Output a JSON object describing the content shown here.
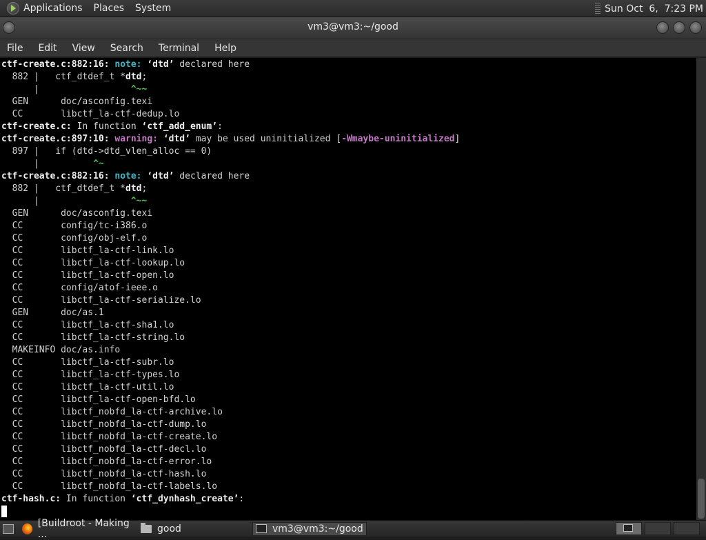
{
  "top_panel": {
    "menus": [
      "Applications",
      "Places",
      "System"
    ],
    "clock": "Sun Oct  6,  7:23 PM"
  },
  "window": {
    "title": "vm3@vm3:~/good"
  },
  "menubar": {
    "items": [
      "File",
      "Edit",
      "View",
      "Search",
      "Terminal",
      "Help"
    ]
  },
  "terminal": {
    "lines": [
      [
        [
          "ctf-create.c:882:16:",
          "b"
        ],
        [
          " ",
          ""
        ],
        [
          "note:",
          "note"
        ],
        [
          " ",
          ""
        ],
        [
          "‘dtd’",
          "q"
        ],
        [
          " declared here",
          ""
        ]
      ],
      [
        [
          "  882 |   ctf_dtdef_t *",
          ""
        ],
        [
          "dtd",
          "b"
        ],
        [
          ";",
          ""
        ]
      ],
      [
        [
          "      |                 ",
          ""
        ],
        [
          "^~~",
          "car"
        ]
      ],
      [
        [
          "  GEN      doc/asconfig.texi",
          ""
        ]
      ],
      [
        [
          "  CC       libctf_la-ctf-dedup.lo",
          ""
        ]
      ],
      [
        [
          "ctf-create.c:",
          "b"
        ],
        [
          " In function ",
          ""
        ],
        [
          "‘ctf_add_enum’",
          "q"
        ],
        [
          ":",
          ""
        ]
      ],
      [
        [
          "ctf-create.c:897:10:",
          "b"
        ],
        [
          " ",
          ""
        ],
        [
          "warning:",
          "warn"
        ],
        [
          " ",
          ""
        ],
        [
          "‘dtd’",
          "q"
        ],
        [
          " may be used uninitialized [",
          ""
        ],
        [
          "-Wmaybe-uninitialized",
          "warn"
        ],
        [
          "]",
          ""
        ]
      ],
      [
        [
          "  897 |   if (dtd->dtd_vlen_alloc == 0)",
          ""
        ]
      ],
      [
        [
          "      |          ",
          ""
        ],
        [
          "^~",
          "car"
        ]
      ],
      [
        [
          "ctf-create.c:882:16:",
          "b"
        ],
        [
          " ",
          ""
        ],
        [
          "note:",
          "note"
        ],
        [
          " ",
          ""
        ],
        [
          "‘dtd’",
          "q"
        ],
        [
          " declared here",
          ""
        ]
      ],
      [
        [
          "  882 |   ctf_dtdef_t *",
          ""
        ],
        [
          "dtd",
          "b"
        ],
        [
          ";",
          ""
        ]
      ],
      [
        [
          "      |                 ",
          ""
        ],
        [
          "^~~",
          "car"
        ]
      ],
      [
        [
          "  GEN      doc/asconfig.texi",
          ""
        ]
      ],
      [
        [
          "  CC       config/tc-i386.o",
          ""
        ]
      ],
      [
        [
          "  CC       config/obj-elf.o",
          ""
        ]
      ],
      [
        [
          "  CC       libctf_la-ctf-link.lo",
          ""
        ]
      ],
      [
        [
          "  CC       libctf_la-ctf-lookup.lo",
          ""
        ]
      ],
      [
        [
          "  CC       libctf_la-ctf-open.lo",
          ""
        ]
      ],
      [
        [
          "  CC       config/atof-ieee.o",
          ""
        ]
      ],
      [
        [
          "  CC       libctf_la-ctf-serialize.lo",
          ""
        ]
      ],
      [
        [
          "  GEN      doc/as.1",
          ""
        ]
      ],
      [
        [
          "  CC       libctf_la-ctf-sha1.lo",
          ""
        ]
      ],
      [
        [
          "  CC       libctf_la-ctf-string.lo",
          ""
        ]
      ],
      [
        [
          "  MAKEINFO doc/as.info",
          ""
        ]
      ],
      [
        [
          "  CC       libctf_la-ctf-subr.lo",
          ""
        ]
      ],
      [
        [
          "  CC       libctf_la-ctf-types.lo",
          ""
        ]
      ],
      [
        [
          "  CC       libctf_la-ctf-util.lo",
          ""
        ]
      ],
      [
        [
          "  CC       libctf_la-ctf-open-bfd.lo",
          ""
        ]
      ],
      [
        [
          "  CC       libctf_nobfd_la-ctf-archive.lo",
          ""
        ]
      ],
      [
        [
          "  CC       libctf_nobfd_la-ctf-dump.lo",
          ""
        ]
      ],
      [
        [
          "  CC       libctf_nobfd_la-ctf-create.lo",
          ""
        ]
      ],
      [
        [
          "  CC       libctf_nobfd_la-ctf-decl.lo",
          ""
        ]
      ],
      [
        [
          "  CC       libctf_nobfd_la-ctf-error.lo",
          ""
        ]
      ],
      [
        [
          "  CC       libctf_nobfd_la-ctf-hash.lo",
          ""
        ]
      ],
      [
        [
          "  CC       libctf_nobfd_la-ctf-labels.lo",
          ""
        ]
      ],
      [
        [
          "ctf-hash.c:",
          "b"
        ],
        [
          " In function ",
          ""
        ],
        [
          "‘ctf_dynhash_create’",
          "q"
        ],
        [
          ":",
          ""
        ]
      ]
    ]
  },
  "taskbar": {
    "tasks": [
      {
        "label": "[Buildroot - Making ...",
        "icon": "firefox-icon",
        "active": false
      },
      {
        "label": "good",
        "icon": "folder-icon",
        "active": false
      },
      {
        "label": "vm3@vm3:~/good",
        "icon": "terminal-icon",
        "active": true
      }
    ]
  }
}
